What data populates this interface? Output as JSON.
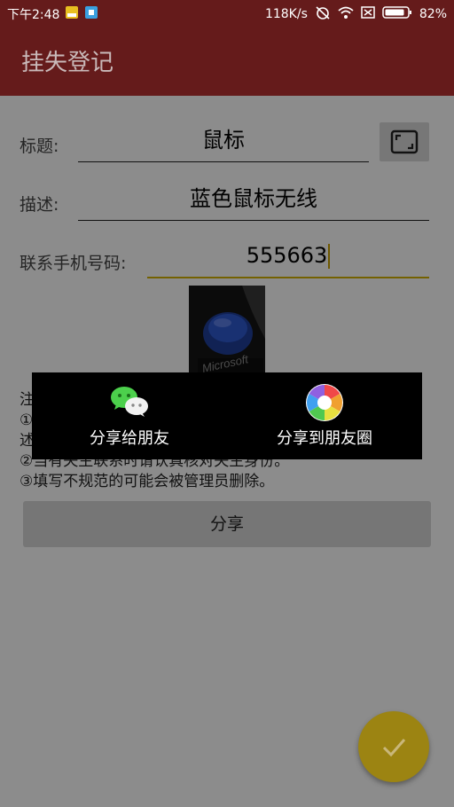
{
  "status_bar": {
    "time": "下午2:48",
    "speed": "118K/s",
    "battery": "82%"
  },
  "app_bar": {
    "title": "挂失登记"
  },
  "form": {
    "title_label": "标题:",
    "title_value": "鼠标",
    "desc_label": "描述:",
    "desc_value": "蓝色鼠标无线",
    "phone_label": "联系手机号码:",
    "phone_value": "555663"
  },
  "notes": {
    "line1": "注",
    "line2": "①",
    "line3": "述",
    "line4": "②当有失主联系时请认真核对失主身份。",
    "line5": "③填写不规范的可能会被管理员删除。"
  },
  "share_button": {
    "label": "分享"
  },
  "share_dialog": {
    "friends_label": "分享给朋友",
    "moments_label": "分享到朋友圈"
  },
  "colors": {
    "app_bar": "#651b1b",
    "accent": "#d4b100",
    "fab": "#9c8412"
  }
}
